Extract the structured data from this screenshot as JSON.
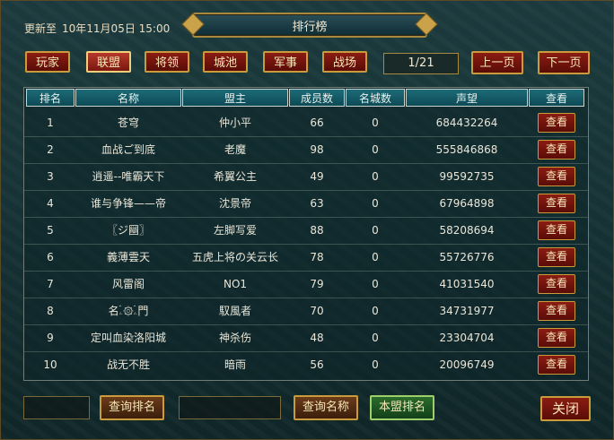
{
  "header": {
    "update_label": "更新至",
    "update_time": "10年11月05日 15:00",
    "title": "排行榜"
  },
  "categories": [
    {
      "label": "玩家",
      "active": false
    },
    {
      "label": "联盟",
      "active": true
    },
    {
      "label": "将领",
      "active": false
    },
    {
      "label": "城池",
      "active": false
    },
    {
      "label": "军事",
      "active": false
    },
    {
      "label": "战场",
      "active": false
    }
  ],
  "pagination": {
    "page_indicator": "1/21",
    "prev_label": "上一页",
    "next_label": "下一页"
  },
  "table": {
    "columns": [
      "排名",
      "名称",
      "盟主",
      "成员数",
      "名城数",
      "声望",
      "查看"
    ],
    "view_label": "查看",
    "rows": [
      {
        "rank": "1",
        "name": "苍穹",
        "leader": "仲小平",
        "members": "66",
        "cities": "0",
        "prestige": "684432264"
      },
      {
        "rank": "2",
        "name": "血战ご到底",
        "leader": "老魔",
        "members": "98",
        "cities": "0",
        "prestige": "555846868"
      },
      {
        "rank": "3",
        "name": "逍遥--唯霸天下",
        "leader": "希翼公主",
        "members": "49",
        "cities": "0",
        "prestige": "99592735"
      },
      {
        "rank": "4",
        "name": "谁与争锋——帝",
        "leader": "沈景帝",
        "members": "63",
        "cities": "0",
        "prestige": "67964898"
      },
      {
        "rank": "5",
        "name": "〖ジ圝〗",
        "leader": "左脚写爱",
        "members": "88",
        "cities": "0",
        "prestige": "58208694"
      },
      {
        "rank": "6",
        "name": "義薄雲天",
        "leader": "五虎上将の关云长",
        "members": "78",
        "cities": "0",
        "prestige": "55726776"
      },
      {
        "rank": "7",
        "name": "风雷阁",
        "leader": "NO1",
        "members": "79",
        "cities": "0",
        "prestige": "41031540"
      },
      {
        "rank": "8",
        "name": "名ۦۘ۞ۦۘ門",
        "leader": "馭風者",
        "members": "70",
        "cities": "0",
        "prestige": "34731977"
      },
      {
        "rank": "9",
        "name": "定叫血染洛阳城",
        "leader": "神杀伤",
        "members": "48",
        "cities": "0",
        "prestige": "23304704"
      },
      {
        "rank": "10",
        "name": "战无不胜",
        "leader": "暗雨",
        "members": "56",
        "cities": "0",
        "prestige": "20096749"
      }
    ]
  },
  "footer": {
    "query_rank_label": "查询排名",
    "query_name_label": "查询名称",
    "alliance_rank_label": "本盟排名",
    "close_label": "关闭"
  }
}
